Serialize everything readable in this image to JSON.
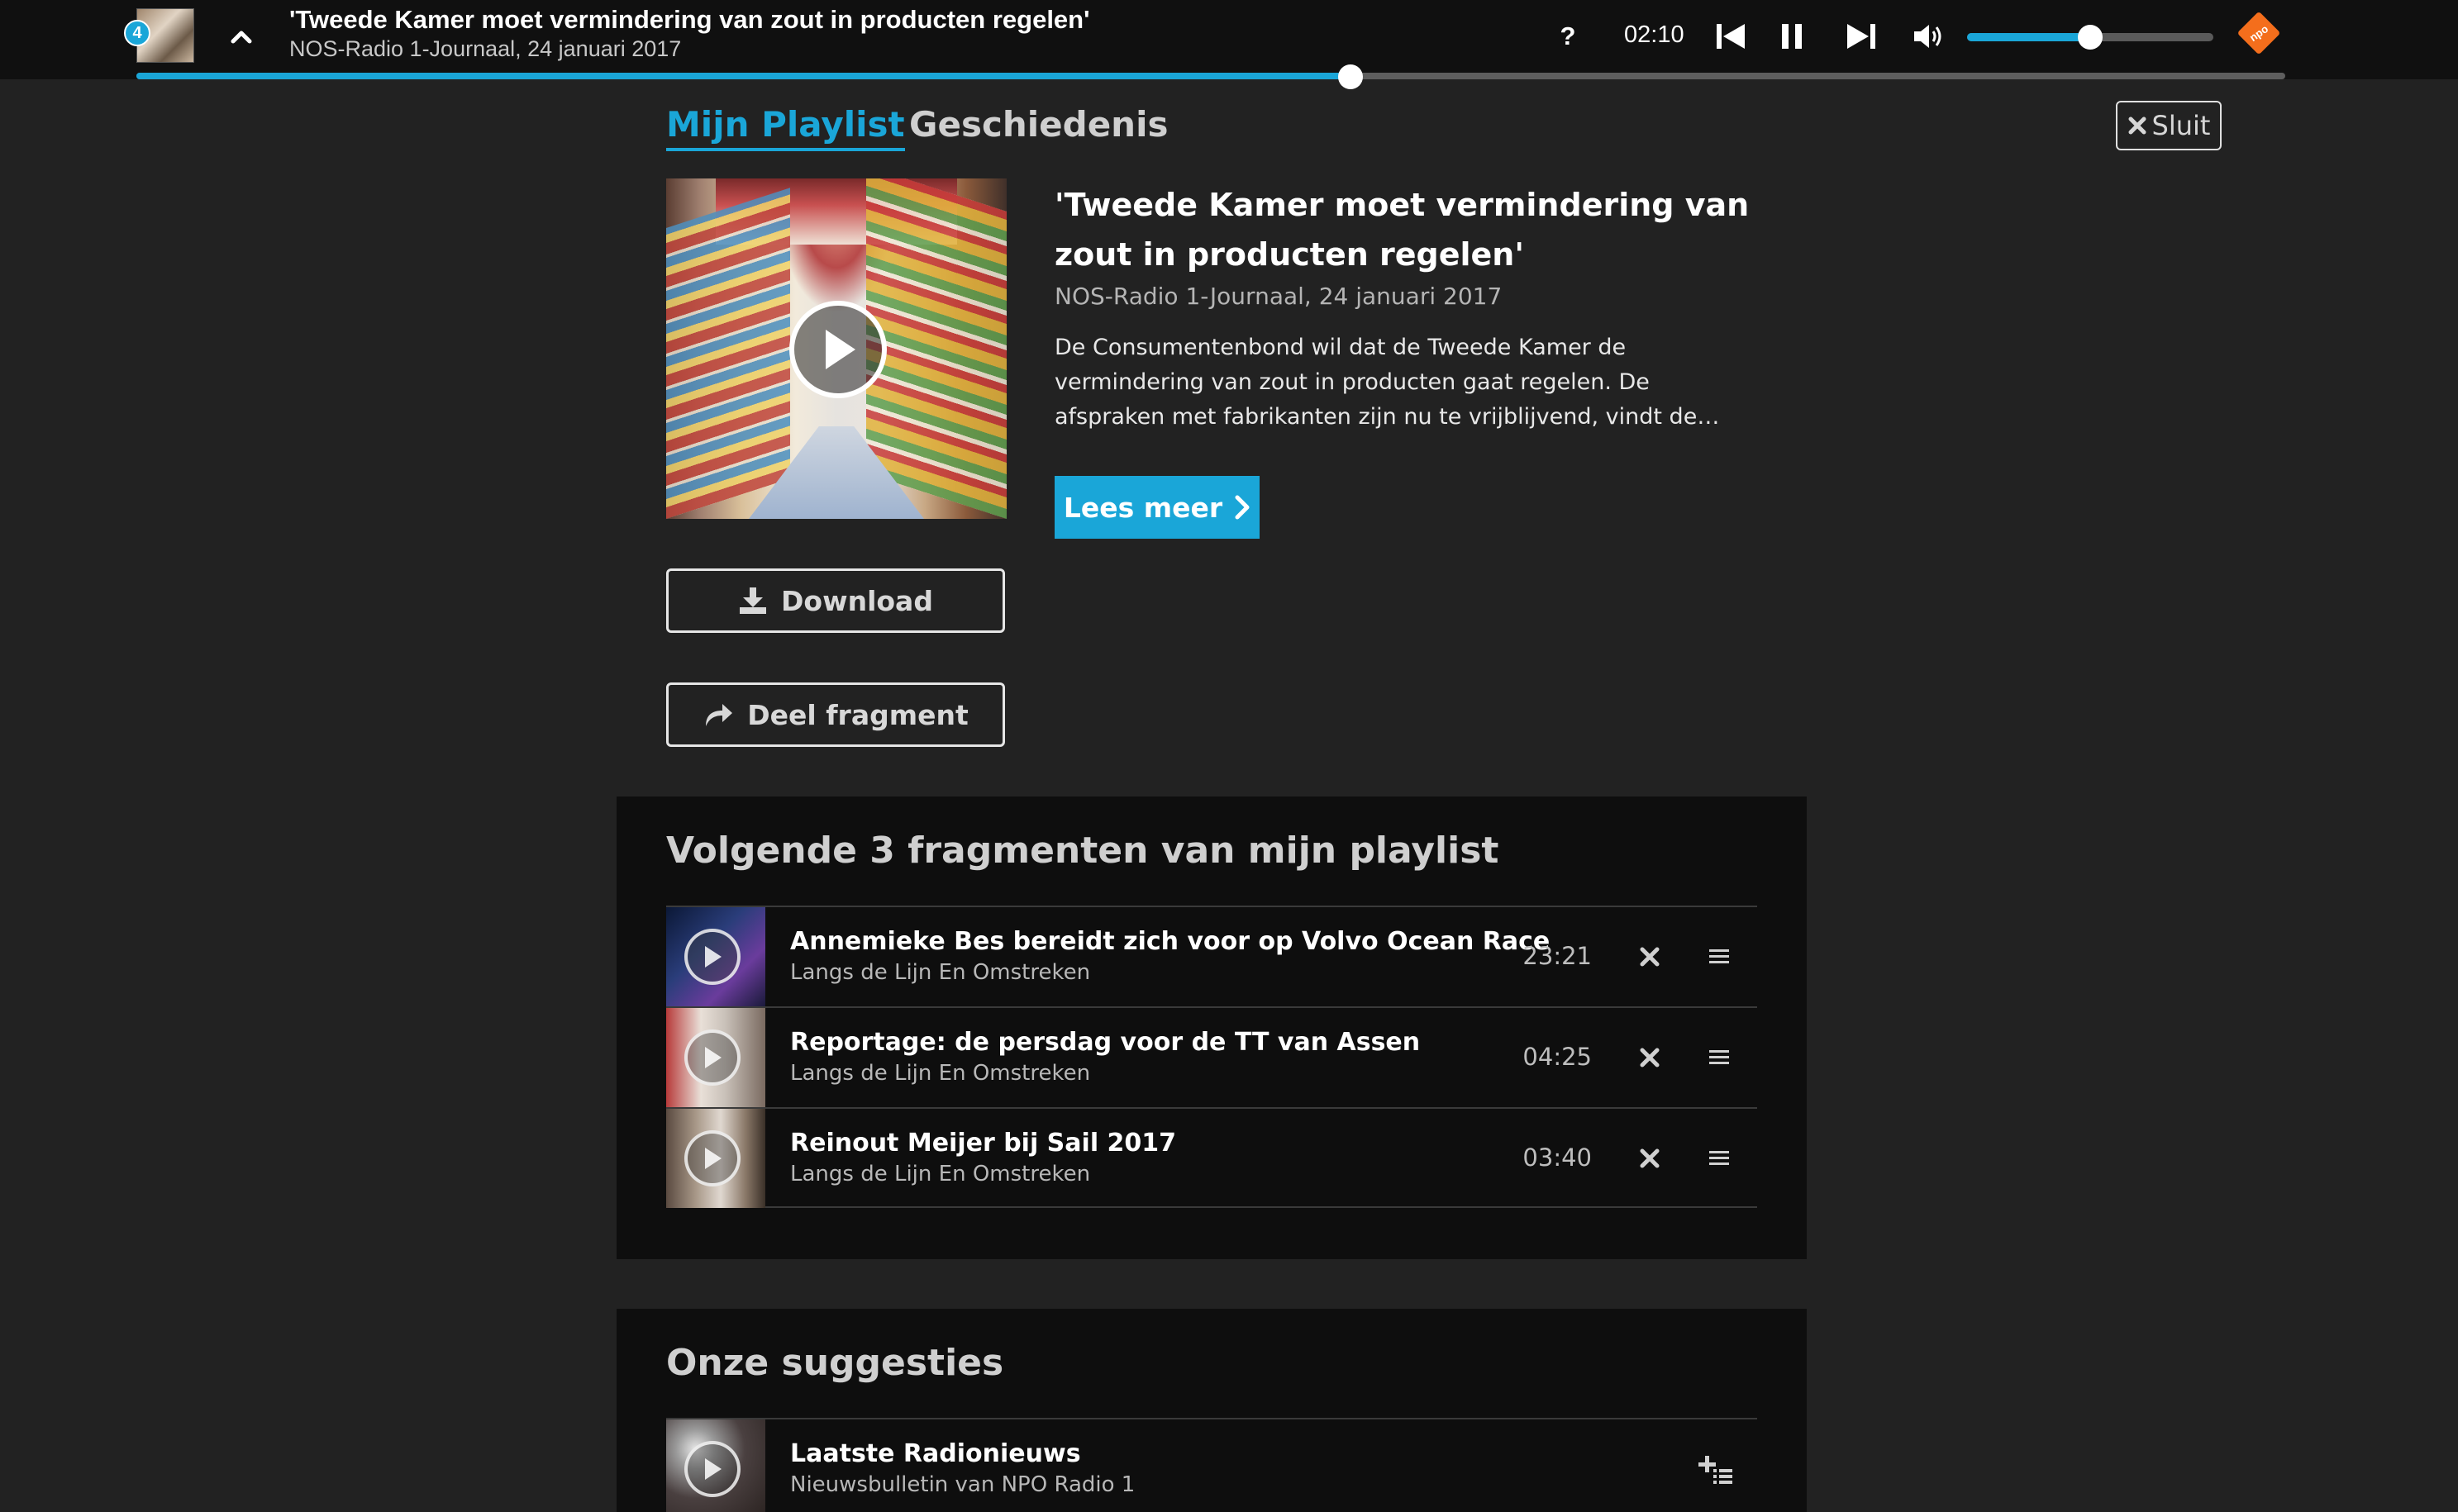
{
  "player": {
    "queue_count": "4",
    "title": "'Tweede Kamer moet vermindering van zout in producten regelen'",
    "subtitle": "NOS-Radio 1-Journaal, 24 januari 2017",
    "help_label": "?",
    "time": "02:10",
    "progress": 0.565,
    "volume": 0.5,
    "icons": [
      "chevron-up-icon",
      "skip-back-icon",
      "pause-icon",
      "skip-forward-icon",
      "volume-icon",
      "npo-logo"
    ],
    "logo_text": "npo"
  },
  "tabs": [
    {
      "label": "Mijn Playlist",
      "active": true
    },
    {
      "label": "Geschiedenis",
      "active": false
    }
  ],
  "close_label": "Sluit",
  "current": {
    "title": "'Tweede Kamer moet vermindering van zout in producten regelen'",
    "meta": "NOS-Radio 1-Journaal, 24 januari 2017",
    "description": "De Consumentenbond wil dat de Tweede Kamer de vermindering van zout in producten gaat regelen. De afspraken met fabrikanten zijn nu te vrijblijvend, vindt de bond. Er zijn grote verschillen tussen...",
    "read_more_label": "Lees meer",
    "download_label": "Download",
    "share_label": "Deel fragment"
  },
  "next": {
    "heading": "Volgende 3 fragmenten van mijn playlist",
    "items": [
      {
        "title": "Annemieke Bes bereidt zich voor op Volvo Ocean Race",
        "subtitle": "Langs de Lijn En Omstreken",
        "duration": "23:21"
      },
      {
        "title": "Reportage: de persdag voor de TT van Assen",
        "subtitle": "Langs de Lijn En Omstreken",
        "duration": "04:25"
      },
      {
        "title": "Reinout Meijer bij Sail 2017",
        "subtitle": "Langs de Lijn En Omstreken",
        "duration": "03:40"
      }
    ]
  },
  "suggestions": {
    "heading": "Onze suggesties",
    "items": [
      {
        "title": "Laatste Radionieuws",
        "subtitle": "Nieuwsbulletin van NPO Radio 1"
      }
    ]
  },
  "colors": {
    "accent": "#1aa6d8",
    "background": "#222222",
    "topbar": "#101010",
    "panel": "#0e0e0e",
    "npo_orange": "#f46e1c"
  }
}
